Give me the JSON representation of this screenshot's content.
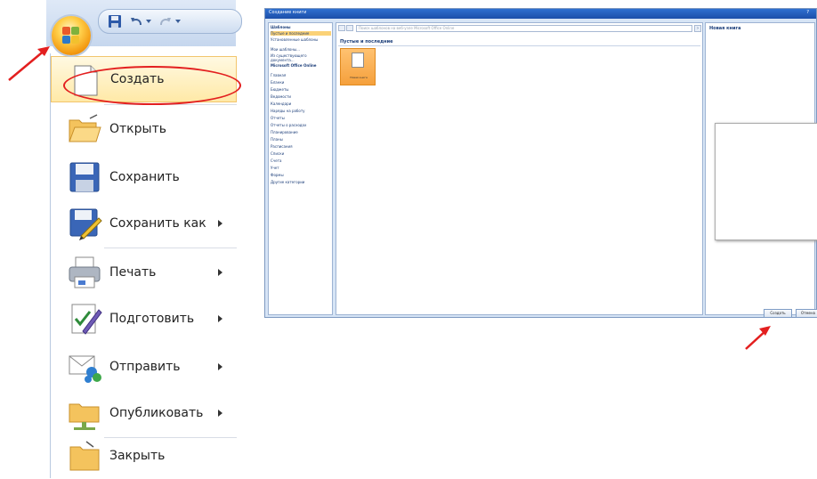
{
  "office_menu": {
    "items": [
      {
        "label": "Создать",
        "icon": "new-document-icon",
        "has_submenu": false,
        "selected": true
      },
      {
        "label": "Открыть",
        "icon": "open-folder-icon",
        "has_submenu": false
      },
      {
        "label": "Сохранить",
        "icon": "save-disk-icon",
        "has_submenu": false
      },
      {
        "label": "Сохранить как",
        "icon": "save-as-icon",
        "has_submenu": true
      },
      {
        "label": "Печать",
        "icon": "printer-icon",
        "has_submenu": true
      },
      {
        "label": "Подготовить",
        "icon": "prepare-document-icon",
        "has_submenu": true
      },
      {
        "label": "Отправить",
        "icon": "send-icon",
        "has_submenu": true
      },
      {
        "label": "Опубликовать",
        "icon": "publish-folder-icon",
        "has_submenu": true
      },
      {
        "label": "Закрыть",
        "icon": "close-folder-icon",
        "has_submenu": false
      }
    ]
  },
  "quick_access": {
    "icons": [
      "office-button-icon",
      "save-icon",
      "undo-icon",
      "redo-icon"
    ]
  },
  "dialog": {
    "title": "Создание книги",
    "help": "?",
    "sidebar": {
      "heading": "Шаблоны",
      "items": [
        "Пустые и последние",
        "Установленные шаблоны",
        "Мои шаблоны...",
        "Из существующего документа...",
        "Microsoft Office Online",
        "Главная",
        "Бланки",
        "Бюджеты",
        "Ведомости",
        "Календари",
        "Наряды на работу",
        "Отчеты",
        "Отчеты о расходах",
        "Планирование",
        "Планы",
        "Расписания",
        "Списки",
        "Счета",
        "Учет",
        "Формы",
        "Другие категории"
      ]
    },
    "search_placeholder": "Поиск шаблонов на веб-узле Microsoft Office Online",
    "section_title": "Пустые и последние",
    "template_label": "Новая книга",
    "preview_title": "Новая книга",
    "buttons": {
      "create": "Создать",
      "cancel": "Отмена"
    }
  },
  "colors": {
    "highlight_red": "#e31f1f",
    "selection_fill": "#ffe9a7",
    "dialog_title_blue": "#1c4ea9"
  }
}
